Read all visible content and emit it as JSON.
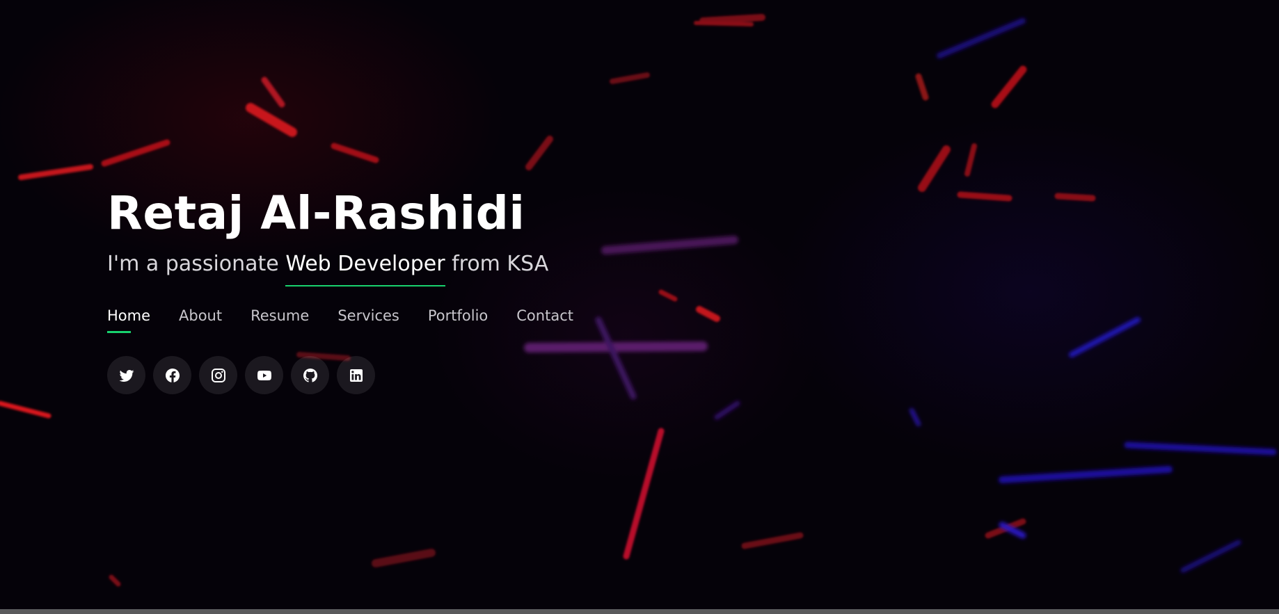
{
  "hero": {
    "name": "Retaj Al-Rashidi",
    "tagline_prefix": "I'm a passionate ",
    "tagline_role": "Web Developer",
    "tagline_suffix": " from KSA"
  },
  "nav": {
    "items": [
      {
        "label": "Home",
        "active": true
      },
      {
        "label": "About",
        "active": false
      },
      {
        "label": "Resume",
        "active": false
      },
      {
        "label": "Services",
        "active": false
      },
      {
        "label": "Portfolio",
        "active": false
      },
      {
        "label": "Contact",
        "active": false
      }
    ]
  },
  "social": {
    "icons": [
      "twitter-icon",
      "facebook-icon",
      "instagram-icon",
      "youtube-icon",
      "github-icon",
      "linkedin-icon"
    ]
  },
  "colors": {
    "accent": "#18d26e",
    "background": "#050209",
    "text": "#ffffff",
    "muted_text": "#c8c6cc"
  }
}
